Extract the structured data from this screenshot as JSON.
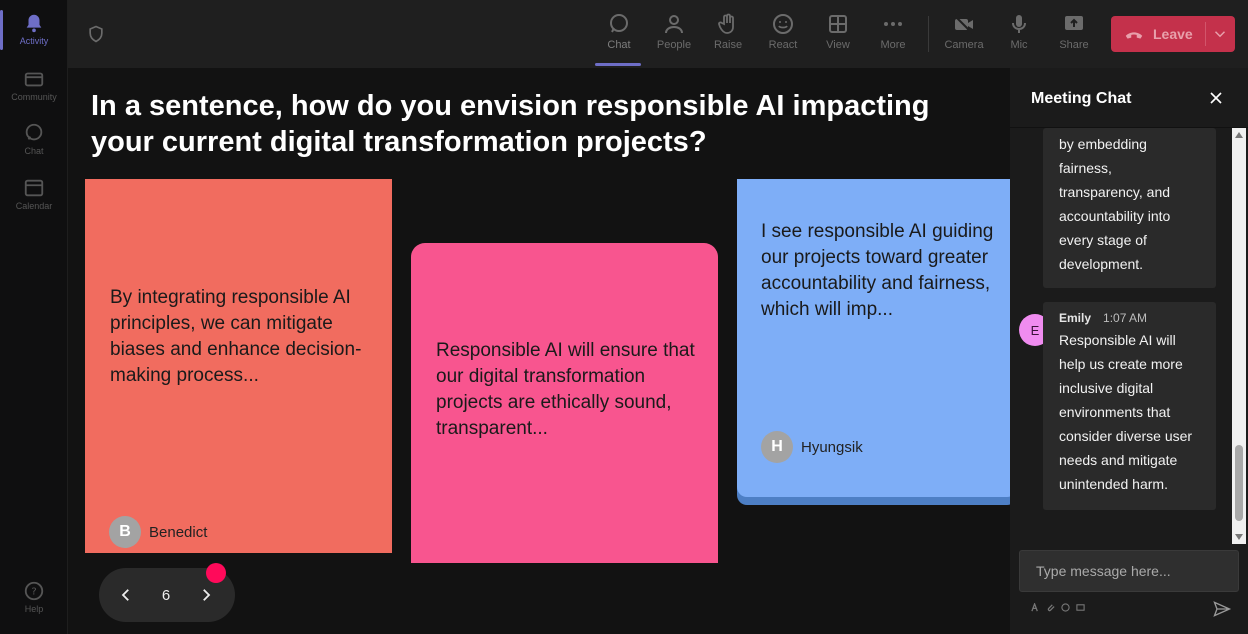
{
  "rail": {
    "items": [
      {
        "label": "Activity",
        "icon": "bell-icon",
        "active": true
      },
      {
        "label": "Community",
        "icon": "community-icon"
      },
      {
        "label": "Chat",
        "icon": "chat-icon"
      },
      {
        "label": "Calendar",
        "icon": "calendar-icon"
      }
    ],
    "help": {
      "label": "Help",
      "icon": "help-icon"
    }
  },
  "toolbar": {
    "chat": "Chat",
    "people": "People",
    "raise": "Raise",
    "react": "React",
    "view": "View",
    "more": "More",
    "camera": "Camera",
    "mic": "Mic",
    "share": "Share",
    "leave": "Leave"
  },
  "stage": {
    "question": "In a sentence, how do you envision responsible AI impacting your current digital transformation projects?",
    "cards": [
      {
        "text": "By integrating responsible AI principles, we can mitigate biases and enhance decision-making process...",
        "initial": "B",
        "author": "Benedict",
        "color": "#f16c5f"
      },
      {
        "text": "Responsible AI will ensure that our digital transformation projects are ethically sound, transparent...",
        "color": "#f8558f"
      },
      {
        "text": "I see responsible AI guiding our projects toward greater accountability and fairness, which will imp...",
        "initial": "H",
        "author": "Hyungsik",
        "color": "#7eaef7"
      }
    ],
    "pager": {
      "page": "6"
    }
  },
  "chat": {
    "title": "Meeting Chat",
    "messages": [
      {
        "lines": [
          "by embedding",
          "fairness,",
          "transparency, and",
          "accountability into",
          "every stage of",
          "development."
        ]
      },
      {
        "author": "Emily",
        "initial": "E",
        "time": "1:07 AM",
        "lines": [
          "Responsible AI will",
          "help us create more",
          "inclusive digital",
          "environments that",
          "consider diverse user",
          "needs and mitigate",
          "unintended harm."
        ]
      }
    ],
    "input": {
      "placeholder": "Type message here...",
      "value": ""
    }
  },
  "colors": {
    "accent": "#6e6ec7",
    "leave": "#c4314b",
    "pointer_dot": "#ff0a5a"
  }
}
